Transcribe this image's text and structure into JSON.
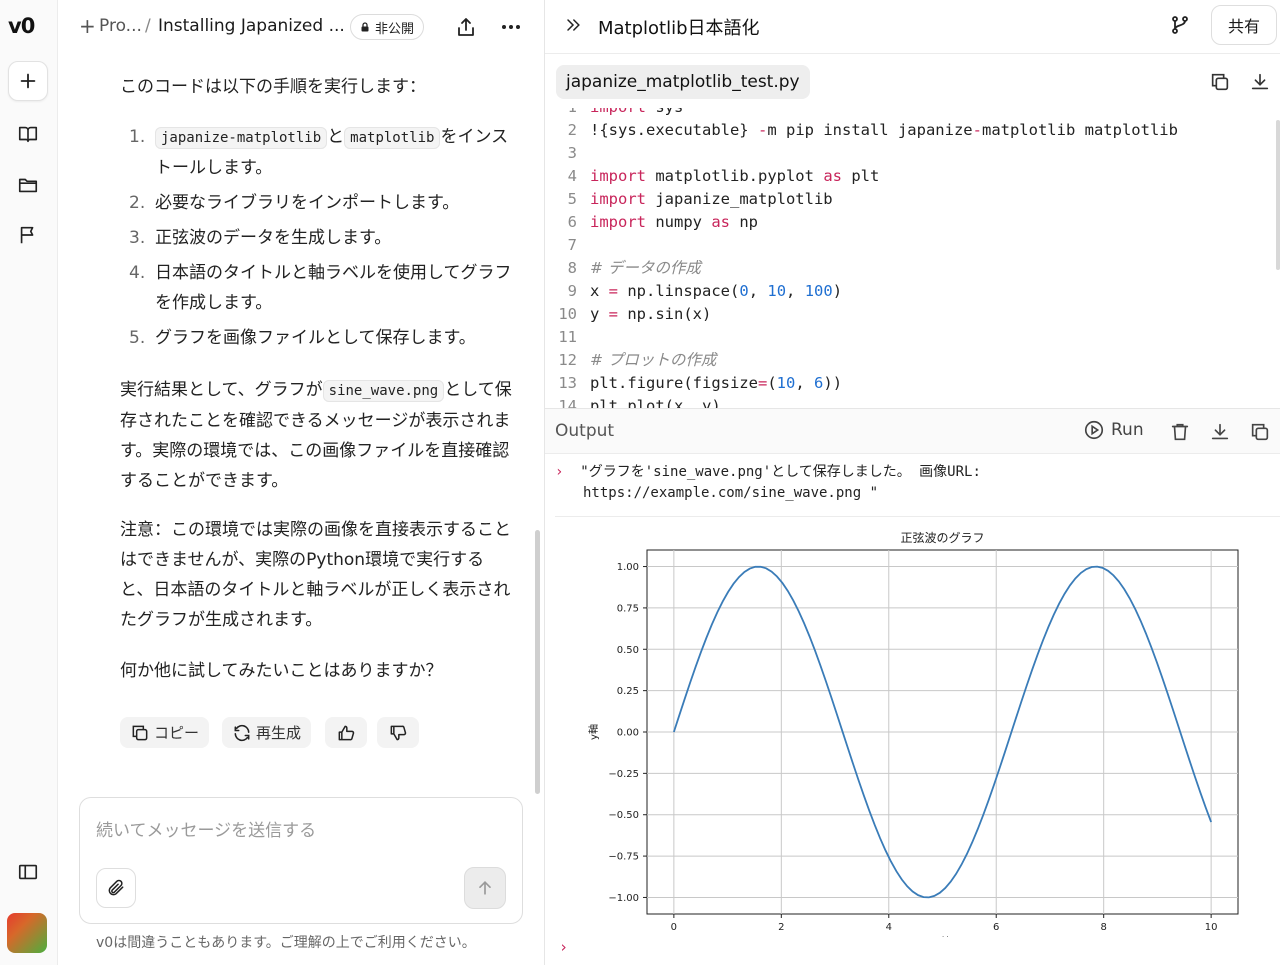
{
  "rail": {
    "logo": "v0",
    "items": [
      "new-chat",
      "library",
      "projects",
      "feedback"
    ],
    "toggle": "sidebar-toggle"
  },
  "chat": {
    "breadcrumb_plus": "+",
    "breadcrumb_project": "Pro...",
    "breadcrumb_sep": "/",
    "breadcrumb_title": "Installing Japanized ...",
    "private_label": "非公開",
    "intro": "このコードは以下の手順を実行します：",
    "steps": [
      {
        "num": "1.",
        "code_a": "japanize-matplotlib",
        "join": "と",
        "code_b": "matplotlib",
        "text": "をインストールします。"
      },
      {
        "num": "2.",
        "text": "必要なライブラリをインポートします。"
      },
      {
        "num": "3.",
        "text": "正弦波のデータを生成します。"
      },
      {
        "num": "4.",
        "text": "日本語のタイトルと軸ラベルを使用してグラフを作成します。"
      },
      {
        "num": "5.",
        "text": "グラフを画像ファイルとして保存します。"
      }
    ],
    "result_pre": "実行結果として、グラフが",
    "result_code": "sine_wave.png",
    "result_post": "として保存されたことを確認できるメッセージが表示されます。実際の環境では、この画像ファイルを直接確認することができます。",
    "note": "注意：この環境では実際の画像を直接表示することはできませんが、実際のPython環境で実行すると、日本語のタイトルと軸ラベルが正しく表示されたグラフが生成されます。",
    "question": "何か他に試してみたいことはありますか？",
    "copy_label": "コピー",
    "regen_label": "再生成",
    "input_placeholder": "続いてメッセージを送信する",
    "disclaimer": "v0は間違うこともあります。ご理解の上でご利用ください。"
  },
  "panel": {
    "title": "Matplotlib日本語化",
    "share_label": "共有",
    "file_tab": "japanize_matplotlib_test.py",
    "code_lines": [
      {
        "n": "1",
        "html": "<span class=\"kw\">import</span> sys"
      },
      {
        "n": "2",
        "html": "!{sys.executable} <span class=\"op\">-</span>m pip install japanize<span class=\"op\">-</span>matplotlib matplotlib"
      },
      {
        "n": "3",
        "html": ""
      },
      {
        "n": "4",
        "html": "<span class=\"kw\">import</span> matplotlib.pyplot <span class=\"kw\">as</span> plt"
      },
      {
        "n": "5",
        "html": "<span class=\"kw\">import</span> japanize_matplotlib"
      },
      {
        "n": "6",
        "html": "<span class=\"kw\">import</span> numpy <span class=\"kw\">as</span> np"
      },
      {
        "n": "7",
        "html": ""
      },
      {
        "n": "8",
        "html": "<span class=\"cm\"># データの作成</span>"
      },
      {
        "n": "9",
        "html": "x <span class=\"op\">=</span> np.linspace(<span class=\"num\">0</span>, <span class=\"num\">10</span>, <span class=\"num\">100</span>)"
      },
      {
        "n": "10",
        "html": "y <span class=\"op\">=</span> np.sin(x)"
      },
      {
        "n": "11",
        "html": ""
      },
      {
        "n": "12",
        "html": "<span class=\"cm\"># プロットの作成</span>"
      },
      {
        "n": "13",
        "html": "plt.figure(figsize<span class=\"op\">=</span>(<span class=\"num\">10</span>, <span class=\"num\">6</span>))"
      },
      {
        "n": "14",
        "html": "plt.plot(x, y)"
      }
    ],
    "output_label": "Output",
    "run_label": "Run",
    "output_line1": "\"グラフを'sine_wave.png'として保存しました。 画像URL:",
    "output_line2": "https://example.com/sine_wave.png \"",
    "chevron": "›"
  },
  "chart_data": {
    "type": "line",
    "title": "正弦波のグラフ",
    "xlabel": "x軸",
    "ylabel": "y軸",
    "xlim": [
      -0.5,
      10.5
    ],
    "ylim": [
      -1.1,
      1.1
    ],
    "xticks": [
      0,
      2,
      4,
      6,
      8,
      10
    ],
    "xtick_labels": [
      "0",
      "2",
      "4",
      "6",
      "8",
      "10"
    ],
    "yticks": [
      1.0,
      0.75,
      0.5,
      0.25,
      0.0,
      -0.25,
      -0.5,
      -0.75,
      -1.0
    ],
    "ytick_labels": [
      "1.00",
      "0.75",
      "0.50",
      "0.25",
      "0.00",
      "−0.25",
      "−0.50",
      "−0.75",
      "−1.00"
    ],
    "grid": true,
    "series": [
      {
        "function": "sin(x)",
        "x_start": 0,
        "x_end": 10,
        "points": 100,
        "color": "#3a7cb8"
      }
    ]
  }
}
